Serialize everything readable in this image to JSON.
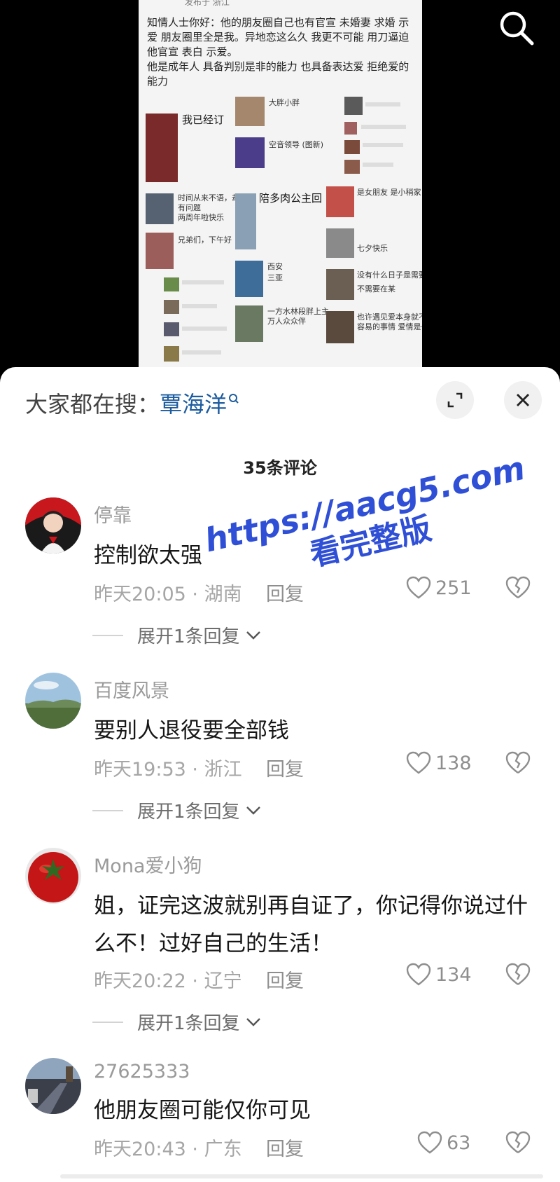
{
  "post": {
    "sub_caption": "发布于 浙江",
    "text": "知情人士你好：他的朋友圈自己也有官宣 未婚妻 求婚 示爱 朋友圈里全是我。异地恋这么久 我更不可能 用刀逼迫他官宣 表白 示爱。\n他是成年人 具备判别是非的能力 也具备表达爱 拒绝爱的能力",
    "collage": {
      "left_caption": "我已经订",
      "left_caption2": "时间从来不语，却",
      "left_caption3": "有问题",
      "left_caption4": "两周年啦快乐",
      "left_caption5": "兄弟们，下午好",
      "mid_caption1": "大胖小胖",
      "mid_caption2": "空音领导 (图新)",
      "mid_caption3": "陪多肉公主回",
      "mid_caption4": "西安",
      "mid_caption5": "三亚",
      "mid_caption6": "一方水林段胖上主",
      "mid_caption7": "万人众众伴",
      "right_caption1": "是女朋友 是小稍家",
      "right_caption2": "七夕快乐",
      "right_caption3": "没有什么日子是需要",
      "right_caption4": "不需要在某",
      "right_caption5": "也许遇见爱本身就不",
      "right_caption6": "容易的事情 爱情是一"
    }
  },
  "search_icon": "search-icon",
  "sheet": {
    "hot_search_label": "大家都在搜：",
    "hot_search_term": "覃海洋",
    "expand_icon": "expand-icon",
    "close_icon": "close-icon",
    "comment_count": "35条评论"
  },
  "comments": [
    {
      "user": "停靠",
      "text": "控制欲太强",
      "time": "昨天20:05",
      "location": "湖南",
      "reply": "回复",
      "likes": "251",
      "expand": "展开1条回复"
    },
    {
      "user": "百度风景",
      "text": "要别人退役要全部钱",
      "time": "昨天19:53",
      "location": "浙江",
      "reply": "回复",
      "likes": "138",
      "expand": "展开1条回复"
    },
    {
      "user": "Mona爱小狗",
      "text": "姐，证完这波就别再自证了，你记得你说过什么不！过好自己的生活！",
      "time": "昨天20:22",
      "location": "辽宁",
      "reply": "回复",
      "likes": "134",
      "expand": "展开1条回复"
    },
    {
      "user": "27625333",
      "text": "他朋友圈可能仅你可见",
      "time": "昨天20:43",
      "location": "广东",
      "reply": "回复",
      "likes": "63"
    }
  ],
  "separator": "·",
  "watermark": {
    "url": "https://aacg5.com",
    "text": "看完整版"
  },
  "colors": {
    "accent_link": "#1d5c9e",
    "watermark": "#2f4fd6"
  }
}
